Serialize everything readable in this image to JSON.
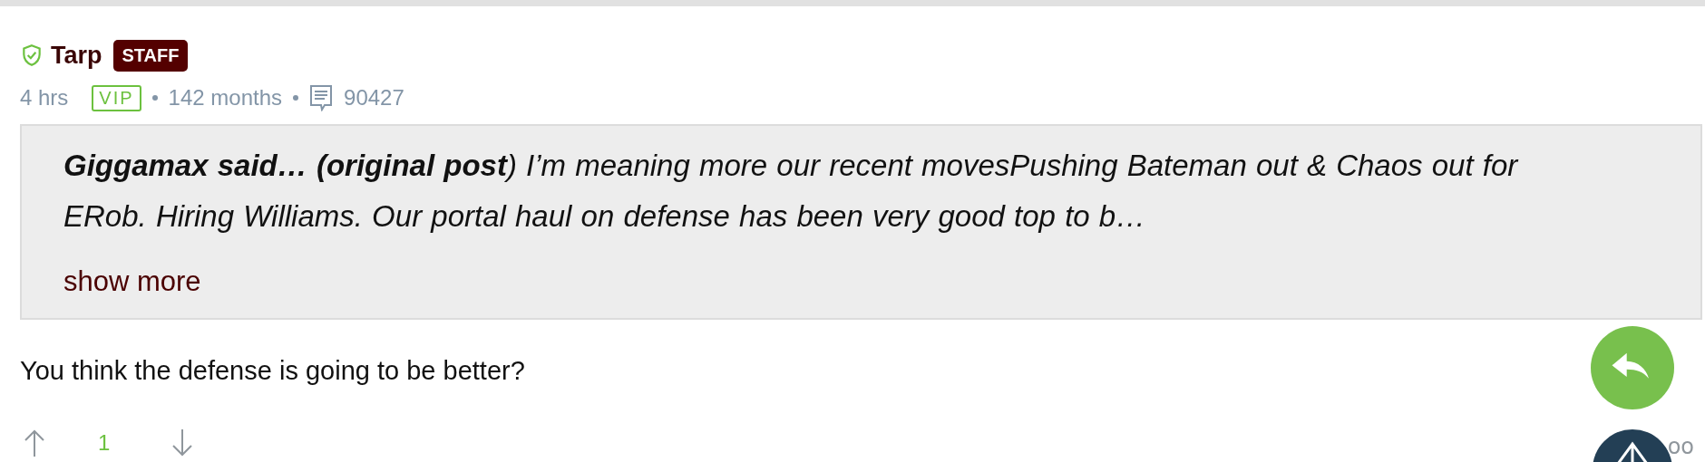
{
  "post": {
    "author": "Tarp",
    "verified": true,
    "badge": "STAFF",
    "time": "4 hrs",
    "tier": "VIP",
    "tenure": "142 months",
    "post_count": "90427",
    "quote": {
      "text": "**Giggamax said… (original post**) I’m meaning more our recent movesPushing Bateman out & Chaos out for ERob. Hiring Williams. Our portal haul on defense has been very good top to b…",
      "more": "show more"
    },
    "body": "You think the defense is going to be better?",
    "votes": {
      "score": "1"
    },
    "cut_text": "oo"
  }
}
